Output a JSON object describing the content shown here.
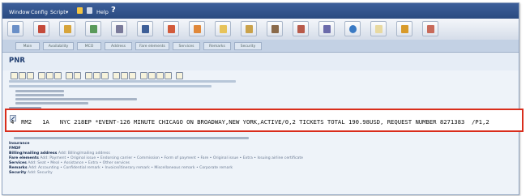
{
  "menu": {
    "items": [
      "Window",
      "Config",
      "Script"
    ]
  },
  "toolbar": {
    "icons": [
      "pnr-icon",
      "fare-icon",
      "calendar-icon",
      "hotel-icon",
      "car-icon",
      "print-icon",
      "queue-icon",
      "person-icon",
      "doc-icon",
      "star-icon",
      "check-icon",
      "bag-icon",
      "card-icon",
      "globe-icon",
      "info-icon",
      "mail-icon",
      "save-icon"
    ]
  },
  "tabs": [
    "Main",
    "Availability",
    "MCO",
    "Address",
    "Fare elements",
    "Services",
    "Remarks",
    "Security"
  ],
  "pnr": {
    "title": "PNR"
  },
  "remark_line": {
    "text": "4  RM2   1A   NYC 218EP *EVENT-126 MINUTE CHICAGO ON BROADWAY,NEW YORK,ACTIVE/0,2 TICKETS TOTAL 190.98USD, REQUEST NUMBER 8271383  /P1,2"
  },
  "sections": {
    "insurance": "Insurance",
    "fmdf": "FMDF",
    "billing": {
      "key": "Billing/mailing address",
      "value": "Add: Billing/mailing address"
    },
    "fare": {
      "key": "Fare elements",
      "value": "Add: Payment • Original issue • Endorsing carrier • Commission • Form of payment • Fare • Original issue • Extra • Issuing airline certificate"
    },
    "services": {
      "key": "Services",
      "value": "Add: Seat • Meal • Assistance • Extra • Other services"
    },
    "remarks": {
      "key": "Remarks",
      "value": "Add: Accounting • Confidential remark • Invoice/itinerary remark • Miscellaneous remark • Corporate remark"
    },
    "security": {
      "key": "Security",
      "value": "Add: Security"
    }
  },
  "colors": {
    "highlight_border": "#d92d1c",
    "menubar": "#2a4a80",
    "title": "#1f3d70"
  }
}
